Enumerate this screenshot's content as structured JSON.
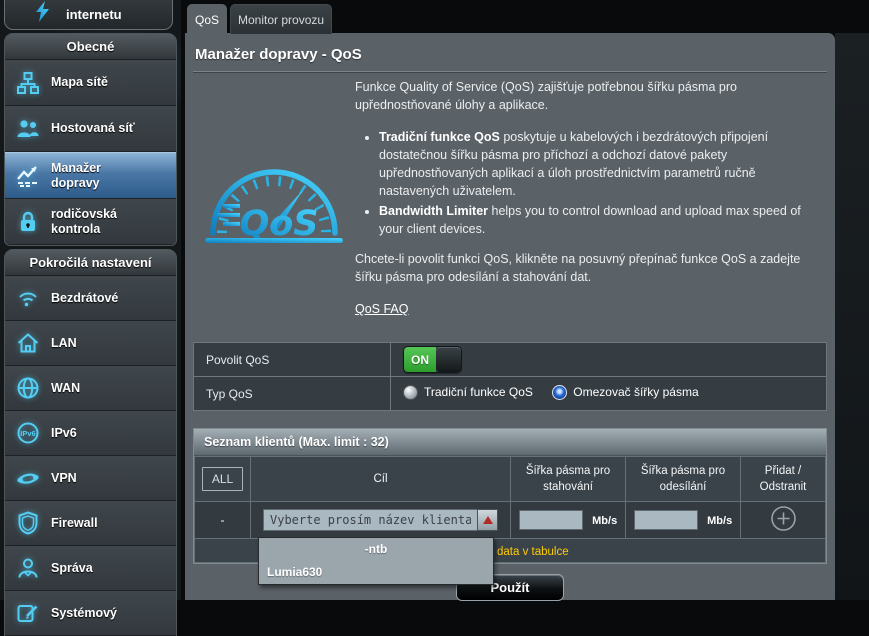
{
  "colors": {
    "accent_blue": "#45c8f1",
    "selected_nav_blue": "#3c6f9e",
    "toggle_green": "#35a935",
    "warning_yellow": "#ffcc00",
    "dropdown_arrow_red": "#b22a22",
    "panel_gray": "#5a6167"
  },
  "sidebar": {
    "quick_setup_label": "internetu",
    "sections": [
      {
        "title": "Obecné"
      },
      {
        "title": "Pokročilá nastavení"
      }
    ],
    "items": [
      {
        "label": "Mapa sítě"
      },
      {
        "label": "Hostovaná síť"
      },
      {
        "label": "Manažer\ndopravy"
      },
      {
        "label": "rodičovská\nkontrola"
      },
      {
        "label": "Bezdrátové"
      },
      {
        "label": "LAN"
      },
      {
        "label": "WAN"
      },
      {
        "label": "IPv6"
      },
      {
        "label": "VPN"
      },
      {
        "label": "Firewall"
      },
      {
        "label": "Správa"
      },
      {
        "label": "Systémový"
      }
    ]
  },
  "tabs": [
    {
      "label": "QoS"
    },
    {
      "label": "Monitor provozu"
    }
  ],
  "page": {
    "title": "Manažer dopravy - QoS"
  },
  "intro": {
    "paragraph1": "Funkce Quality of Service (QoS) zajišťuje potřebnou šířku pásma pro upřednostňované úlohy a aplikace.",
    "bullet1_bold": "Tradiční funkce QoS",
    "bullet1_rest": " poskytuje u kabelových i bezdrátových připojení dostatečnou šířku pásma pro příchozí a odchozí datové pakety upřednostňovaných aplikací a úloh prostřednictvím parametrů ručně nastavených uživatelem.",
    "bullet2_bold": "Bandwidth Limiter",
    "bullet2_rest": " helps you to control download and upload max speed of your client devices.",
    "paragraph2": "Chcete-li povolit funkci QoS, klikněte na posuvný přepínač funkce QoS a zadejte šířku pásma pro odesílání a stahování dat.",
    "faq_link_label": "QoS FAQ"
  },
  "settings": {
    "enable_label": "Povolit QoS",
    "toggle_state": "ON",
    "type_label": "Typ QoS",
    "type_options": [
      {
        "label": "Tradiční funkce QoS",
        "selected": false
      },
      {
        "label": "Omezovač šířky pásma",
        "selected": true
      }
    ]
  },
  "client_table": {
    "title": "Seznam klientů (Max. limit : 32)",
    "all_button_label": "ALL",
    "columns": {
      "target": "Cíl",
      "download": "Šířka pásma pro stahování",
      "upload": "Šířka pásma pro odesílání",
      "action": "Přidat / Odstranit"
    },
    "row": {
      "index_label": "-",
      "combobox_placeholder": "Vyberte prosím název klienta",
      "download_value": "",
      "upload_value": "",
      "unit": "Mb/s"
    },
    "no_data_visible_text": "data v tabulce",
    "dropdown_items": [
      {
        "label": "-ntb"
      },
      {
        "label": "Lumia630"
      }
    ]
  },
  "apply_button_label": "Použít"
}
